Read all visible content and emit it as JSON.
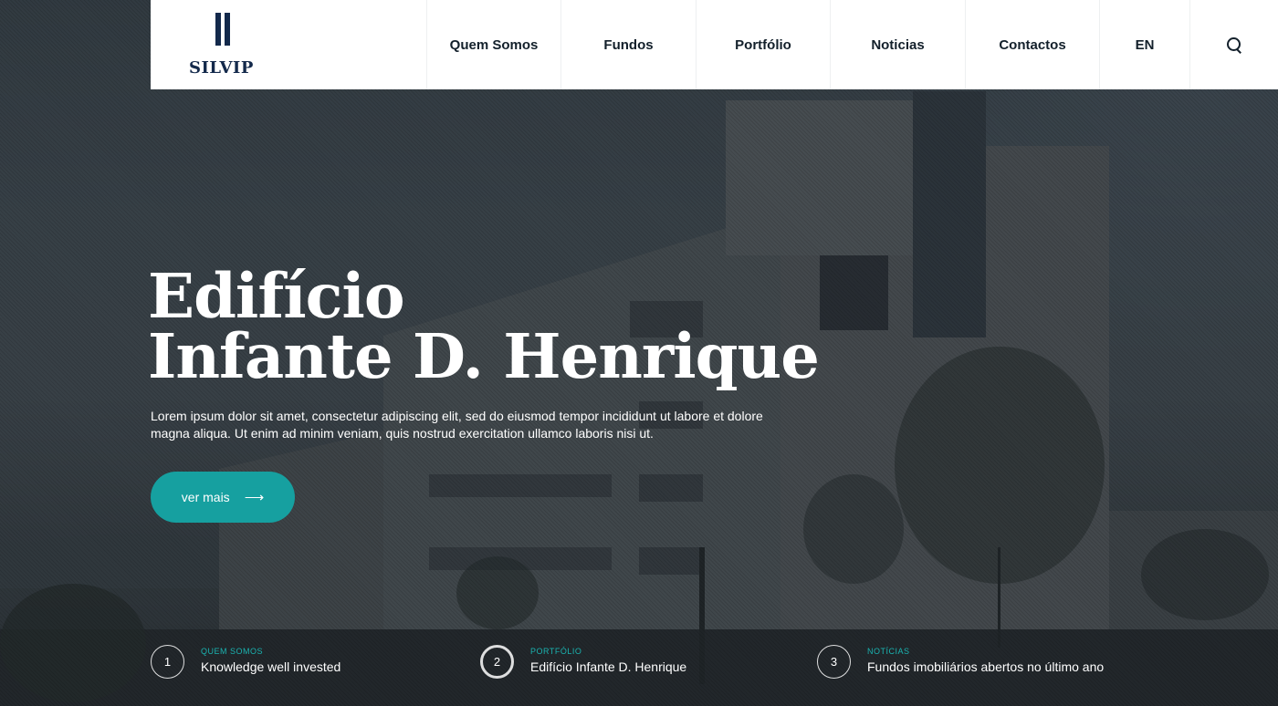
{
  "brand": {
    "name": "SILVIP"
  },
  "nav": {
    "items": [
      "Quem Somos",
      "Fundos",
      "Portfólio",
      "Noticias",
      "Contactos"
    ],
    "language": "EN",
    "search_icon": "search-icon"
  },
  "hero": {
    "title_line1": "Edifício",
    "title_line2": "Infante D. Henrique",
    "description": "Lorem ipsum dolor sit amet, consectetur adipiscing elit, sed do eiusmod tempor incididunt ut labore et dolore magna aliqua. Ut enim ad minim veniam, quis nostrud exercitation ullamco laboris nisi ut.",
    "cta_label": "ver mais",
    "cta_icon": "arrow-right-icon"
  },
  "slides": [
    {
      "number": "1",
      "category": "QUEM SOMOS",
      "title": "Knowledge well invested",
      "active": false
    },
    {
      "number": "2",
      "category": "PORTFÓLIO",
      "title": "Edifício Infante D. Henrique",
      "active": true
    },
    {
      "number": "3",
      "category": "NOTÍCIAS",
      "title": "Fundos imobiliários abertos no último ano",
      "active": false
    }
  ],
  "colors": {
    "brand_navy": "#13294b",
    "accent_teal": "#16a0a0",
    "category_teal": "#1ab3b0",
    "header_bg": "#ffffff"
  }
}
